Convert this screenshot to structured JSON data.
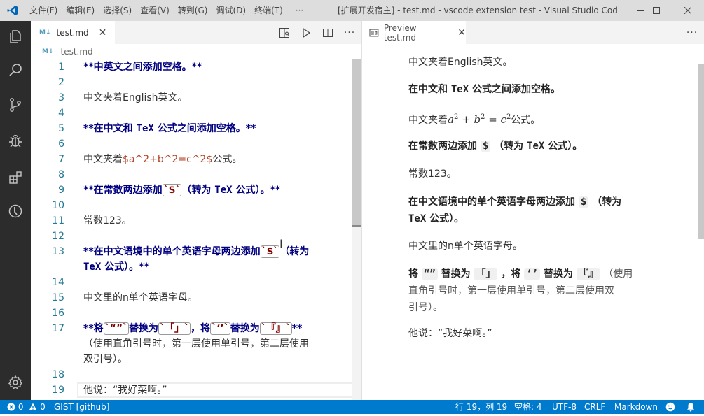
{
  "menu": [
    "文件(F)",
    "编辑(E)",
    "选择(S)",
    "查看(V)",
    "转到(G)",
    "调试(D)",
    "终端(T)",
    "···"
  ],
  "window_title": "[扩展开发宿主] - test.md - vscode extension test - Visual Studio Code ...",
  "colors": {
    "accent": "#007acc",
    "activitybar": "#2c2c2c",
    "titlebar": "#dddddd",
    "heading": "#000080",
    "line_number": "#237893"
  },
  "activity_icons": [
    "files-icon",
    "search-icon",
    "source-control-icon",
    "debug-icon",
    "extensions-icon",
    "timeline-icon",
    "gear-icon"
  ],
  "editor": {
    "tab_label": "test.md",
    "tab_icon": "M↓",
    "breadcrumb": "test.md",
    "lines": [
      {
        "n": "1",
        "parts": [
          [
            "b",
            "**中英文之间添加空格。**"
          ]
        ]
      },
      {
        "n": "2",
        "parts": []
      },
      {
        "n": "3",
        "parts": [
          [
            "t",
            "中文夹着English英文。"
          ]
        ]
      },
      {
        "n": "4",
        "parts": []
      },
      {
        "n": "5",
        "parts": [
          [
            "b",
            "**在中文和 "
          ],
          [
            "bm",
            "TeX"
          ],
          [
            "b",
            " 公式之间添加空格。**"
          ]
        ]
      },
      {
        "n": "6",
        "parts": []
      },
      {
        "n": "7",
        "parts": [
          [
            "t",
            "中文夹着"
          ],
          [
            "d",
            "$a^2+b^2=c^2$"
          ],
          [
            "t",
            "公式。"
          ]
        ]
      },
      {
        "n": "8",
        "parts": []
      },
      {
        "n": "9",
        "parts": [
          [
            "b",
            "**在常数两边添加"
          ],
          [
            "c",
            "`$`"
          ],
          [
            "b",
            "（转为 "
          ],
          [
            "bm",
            "TeX"
          ],
          [
            "b",
            " 公式）。**"
          ]
        ]
      },
      {
        "n": "10",
        "parts": []
      },
      {
        "n": "11",
        "parts": [
          [
            "t",
            "常数123。"
          ]
        ]
      },
      {
        "n": "12",
        "parts": []
      },
      {
        "n": "13",
        "parts": [
          [
            "b",
            "**在中文语境中的单个英语字母两边添加"
          ],
          [
            "c",
            "`$`"
          ],
          [
            "b",
            "（转为\n"
          ],
          [
            "bm",
            "TeX"
          ],
          [
            "b",
            " 公式）。**"
          ]
        ]
      },
      {
        "n": "14",
        "parts": []
      },
      {
        "n": "15",
        "parts": [
          [
            "t",
            "中文里的n单个英语字母。"
          ]
        ]
      },
      {
        "n": "16",
        "parts": []
      },
      {
        "n": "17",
        "parts": [
          [
            "b",
            "**将"
          ],
          [
            "c",
            "`“”`"
          ],
          [
            "b",
            "替换为"
          ],
          [
            "c",
            "`「」`"
          ],
          [
            "b",
            "，将"
          ],
          [
            "c",
            "`‘’`"
          ],
          [
            "b",
            "替换为"
          ],
          [
            "c",
            "`『』`"
          ],
          [
            "b",
            "**"
          ],
          [
            "t",
            "\n（使用直角引号时，第一层使用单引号，第二层使用\n双引号）。"
          ]
        ]
      },
      {
        "n": "18",
        "parts": []
      },
      {
        "n": "19",
        "parts": [
          [
            "t",
            "他说：“我好菜啊。”"
          ]
        ]
      }
    ]
  },
  "preview": {
    "tab_label": "Preview test.md",
    "p1": "中文夹着English英文。",
    "p2a": "在中文和 ",
    "p2b": "TeX",
    "p2c": " 公式之间添加空格。",
    "p3a": "中文夹着",
    "p3b": "公式。",
    "p3_math": {
      "a": "a",
      "b": "b",
      "c": "c",
      "exp": "2",
      "plus": " + ",
      "eq": " = "
    },
    "p4a": "在常数两边添加 ",
    "p4b": "$",
    "p4c": " （转为 ",
    "p4d": "TeX",
    "p4e": " 公式）。",
    "p5": "常数123。",
    "p6a": "在中文语境中的单个英语字母两边添加 ",
    "p6b": "$",
    "p6c": " （转为",
    "p6d": "TeX",
    "p6e": " 公式）。",
    "p7": "中文里的n单个英语字母。",
    "p8a": "将 ",
    "p8b": "“”",
    "p8c": " 替换为 ",
    "p8d": "「」",
    "p8e": " ，将 ",
    "p8f": "‘’",
    "p8g": " 替换为 ",
    "p8h": "『』",
    "p8i": " （使用",
    "p8j": "直角引号时，第一层使用单引号，第二层使用双",
    "p8k": "引号）。",
    "p9": "他说：“我好菜啊。”"
  },
  "status": {
    "errors": "0",
    "warnings": "0",
    "branch": "GIST [github]",
    "position": "行 19，列 19",
    "spaces": "空格: 4",
    "encoding": "UTF-8",
    "eol": "CRLF",
    "language": "Markdown"
  }
}
